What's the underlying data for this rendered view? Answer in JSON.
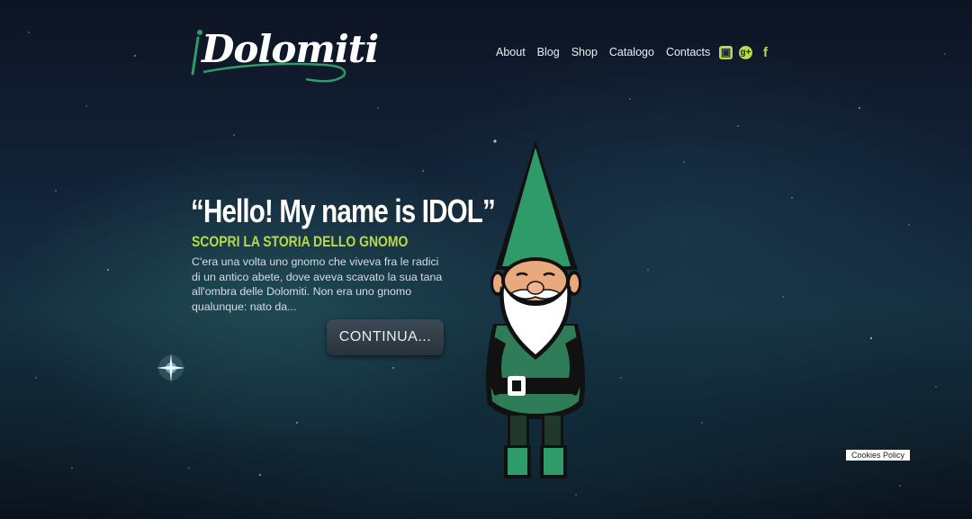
{
  "brand": {
    "logo_text": "Dolomiti",
    "logo_prefix": "i"
  },
  "nav": {
    "items": [
      "About",
      "Blog",
      "Shop",
      "Catalogo",
      "Contacts"
    ]
  },
  "social": {
    "icons": [
      "instagram-icon",
      "google-plus-icon",
      "facebook-icon"
    ],
    "accent": "#b9d94a"
  },
  "hero": {
    "title": "“Hello! My name is IDOL”",
    "subtitle": "SCOPRI LA STORIA DELLO GNOMO",
    "body": "C'era una volta uno gnomo che viveva fra le radici di un antico abete, dove aveva scavato la sua tana all'ombra delle Dolomiti. Non era uno gnomo qualunque: nato da...",
    "cta_label": "CONTINUA..."
  },
  "cookies": {
    "label": "Cookies Policy"
  },
  "colors": {
    "accent": "#b9d94a",
    "gnome_green": "#2e8b5f",
    "hat_green": "#2f9a6a"
  }
}
